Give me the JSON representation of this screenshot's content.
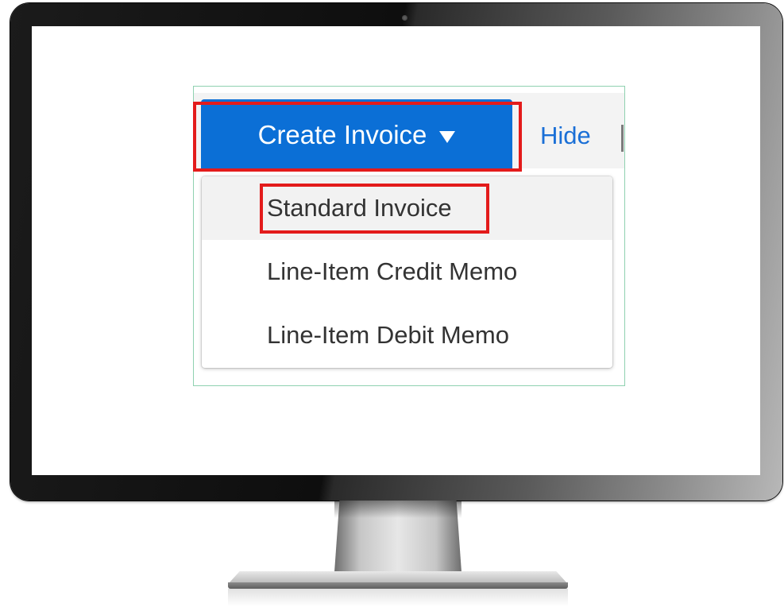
{
  "create_button": {
    "label": "Create Invoice",
    "icon": "caret-down-icon",
    "color": "#0b6fd6"
  },
  "toolbar": {
    "hide_label": "Hide"
  },
  "dropdown": {
    "items": [
      {
        "label": "Standard Invoice",
        "highlighted": true
      },
      {
        "label": "Line-Item Credit Memo",
        "highlighted": false
      },
      {
        "label": "Line-Item Debit Memo",
        "highlighted": false
      }
    ]
  },
  "colors": {
    "annotation_red": "#e31b1b",
    "link_blue": "#1a6fd6",
    "snippet_border": "#8fd1b0"
  }
}
